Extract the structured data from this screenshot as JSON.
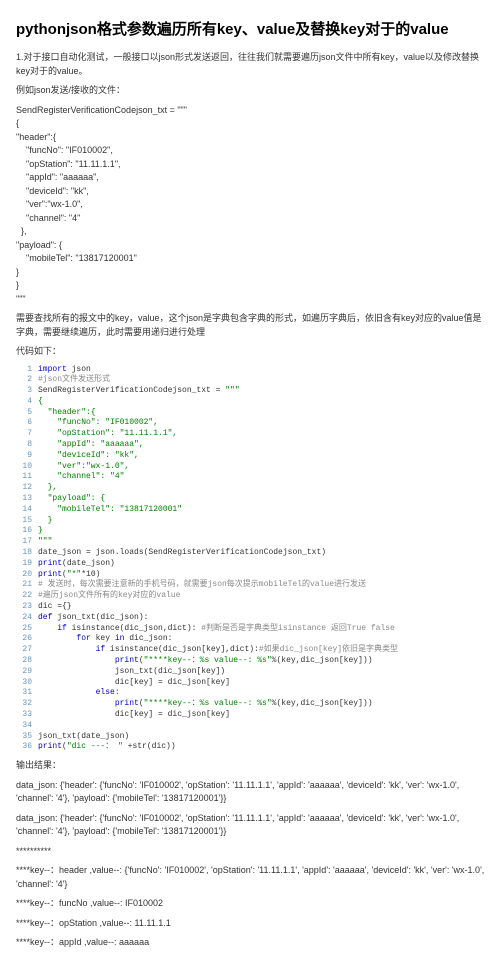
{
  "title": "pythonjson格式参数遍历所有key、value及替换key对于的value",
  "p1": "1.对于接口自动化测试，一般接口以json形式发送返回，往往我们就需要遍历json文件中所有key，value以及修改替换key对于的value。",
  "p2": "例如json发送/接收的文件：",
  "jsonSample": "SendRegisterVerificationCodejson_txt = \"\"\"\n{\n\"header\":{\n    \"funcNo\": \"IF010002\",\n    \"opStation\": \"11.11.1.1\",\n    \"appId\": \"aaaaaa\",\n    \"deviceId\": \"kk\",\n    \"ver\":\"wx-1.0\",\n    \"channel\": \"4\"\n  },\n\"payload\": {\n    \"mobileTel\": \"13817120001\"\n}\n}\n\"\"\"",
  "p3": "需要查找所有的报文中的key，value，这个json是字典包含字典的形式，如遍历字典后，依旧含有key对应的value值是字典，需要继续遍历，此时需要用递归进行处理",
  "p4": "代码如下：",
  "code": [
    {
      "n": "1",
      "html": "<span class='kw'>import</span> json"
    },
    {
      "n": "2",
      "html": "<span class='cm'>#json文件发送形式</span>"
    },
    {
      "n": "3",
      "html": "SendRegisterVerificationCodejson_txt = <span class='str'>\"\"\"</span>"
    },
    {
      "n": "4",
      "html": "<span class='str'>{</span>"
    },
    {
      "n": "5",
      "html": "<span class='str'>  \"header\":{</span>"
    },
    {
      "n": "6",
      "html": "<span class='str'>    \"funcNo\": \"IF010002\",</span>"
    },
    {
      "n": "7",
      "html": "<span class='str'>    \"opStation\": \"11.11.1.1\",</span>"
    },
    {
      "n": "8",
      "html": "<span class='str'>    \"appId\": \"aaaaaa\",</span>"
    },
    {
      "n": "9",
      "html": "<span class='str'>    \"deviceId\": \"kk\",</span>"
    },
    {
      "n": "10",
      "html": "<span class='str'>    \"ver\":\"wx-1.0\",</span>"
    },
    {
      "n": "11",
      "html": "<span class='str'>    \"channel\": \"4\"</span>"
    },
    {
      "n": "12",
      "html": "<span class='str'>  },</span>"
    },
    {
      "n": "13",
      "html": "<span class='str'>  \"payload\": {</span>"
    },
    {
      "n": "14",
      "html": "<span class='str'>    \"mobileTel\": \"13817120001\"</span>"
    },
    {
      "n": "15",
      "html": "<span class='str'>  }</span>"
    },
    {
      "n": "16",
      "html": "<span class='str'>}</span>"
    },
    {
      "n": "17",
      "html": "<span class='str'>\"\"\"</span>"
    },
    {
      "n": "18",
      "html": "date_json = json.loads(SendRegisterVerificationCodejson_txt)"
    },
    {
      "n": "19",
      "html": "<span class='kw'>print</span>(date_json)"
    },
    {
      "n": "20",
      "html": "<span class='kw'>print</span>(<span class='str'>\"*\"</span>*10)"
    },
    {
      "n": "21",
      "html": "<span class='cm'># 发送时，每次需要注意新的⼿机号码，就需要json每次提示mobileTel的value进⾏发送</span>"
    },
    {
      "n": "22",
      "html": "<span class='cm'>#遍历json⽂件所有的key对应的value</span>"
    },
    {
      "n": "23",
      "html": "dic ={}"
    },
    {
      "n": "24",
      "html": "<span class='kw'>def</span> json_txt(dic_json):"
    },
    {
      "n": "25",
      "html": "    <span class='kw'>if</span> isinstance(dic_json,dict): <span class='cm'>#判断是否是字典类型isinstance 返回True false</span>"
    },
    {
      "n": "26",
      "html": "        <span class='kw'>for</span> key <span class='kw'>in</span> dic_json:"
    },
    {
      "n": "27",
      "html": "            <span class='kw'>if</span> isinstance(dic_json[key],dict):<span class='cm'>#如果dic_json[key]依旧是字典类型</span>"
    },
    {
      "n": "28",
      "html": "                <span class='kw'>print</span>(<span class='str'>\"****key--：%s value--: %s\"</span>%(key,dic_json[key]))"
    },
    {
      "n": "29",
      "html": "                json_txt(dic_json[key])"
    },
    {
      "n": "30",
      "html": "                dic[key] = dic_json[key]"
    },
    {
      "n": "31",
      "html": "            <span class='kw'>else</span>:"
    },
    {
      "n": "32",
      "html": "                <span class='kw'>print</span>(<span class='str'>\"****key--：%s value--: %s\"</span>%(key,dic_json[key]))"
    },
    {
      "n": "33",
      "html": "                dic[key] = dic_json[key]"
    },
    {
      "n": "34",
      "html": ""
    },
    {
      "n": "35",
      "html": "json_txt(date_json)"
    },
    {
      "n": "36",
      "html": "<span class='kw'>print</span>(<span class='str'>\"dic ---： \"</span> +str(dic))"
    }
  ],
  "p5": "输出结果：",
  "out1": "data_json:  {'header': {'funcNo': 'IF010002', 'opStation': '11.11.1.1', 'appId': 'aaaaaa', 'deviceId': 'kk', 'ver': 'wx-1.0', 'channel': '4'}, 'payload': {'mobileTel': '13817120001'}}",
  "out2": "data_json:  {'header': {'funcNo': 'IF010002', 'opStation': '11.11.1.1', 'appId': 'aaaaaa', 'deviceId': 'kk', 'ver': 'wx-1.0', 'channel': '4'}, 'payload': {'mobileTel': '13817120001'}}",
  "out3": "**********",
  "out4": "****key--：header ,value--: {'funcNo': 'IF010002', 'opStation': '11.11.1.1', 'appId': 'aaaaaa', 'deviceId': 'kk', 'ver': 'wx-1.0', 'channel': '4'}",
  "out5": "****key--：funcNo ,value--: IF010002",
  "out6": "****key--：opStation ,value--: 11.11.1.1",
  "out7": "****key--：appId ,value--: aaaaaa"
}
